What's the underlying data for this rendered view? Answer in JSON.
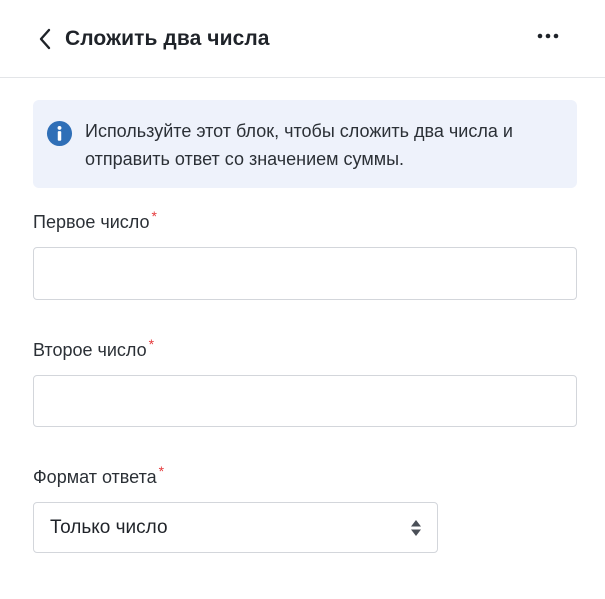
{
  "header": {
    "title": "Сложить два числа",
    "back_icon": "chevron-left-icon",
    "more_icon": "more-horizontal-icon"
  },
  "info": {
    "icon": "info-icon",
    "text": "Используйте этот блок, чтобы сложить два числа и отправить ответ со значением суммы."
  },
  "fields": {
    "first_number": {
      "label": "Первое число",
      "required_mark": "*",
      "value": "",
      "placeholder": ""
    },
    "second_number": {
      "label": "Второе число",
      "required_mark": "*",
      "value": "",
      "placeholder": ""
    },
    "answer_format": {
      "label": "Формат ответа",
      "required_mark": "*",
      "selected": "Только число",
      "icon": "select-updown-icon"
    }
  },
  "colors": {
    "info_background": "#eef2fb",
    "info_icon": "#2f6fb7",
    "required": "#e5393b",
    "border": "#d3d6db"
  }
}
